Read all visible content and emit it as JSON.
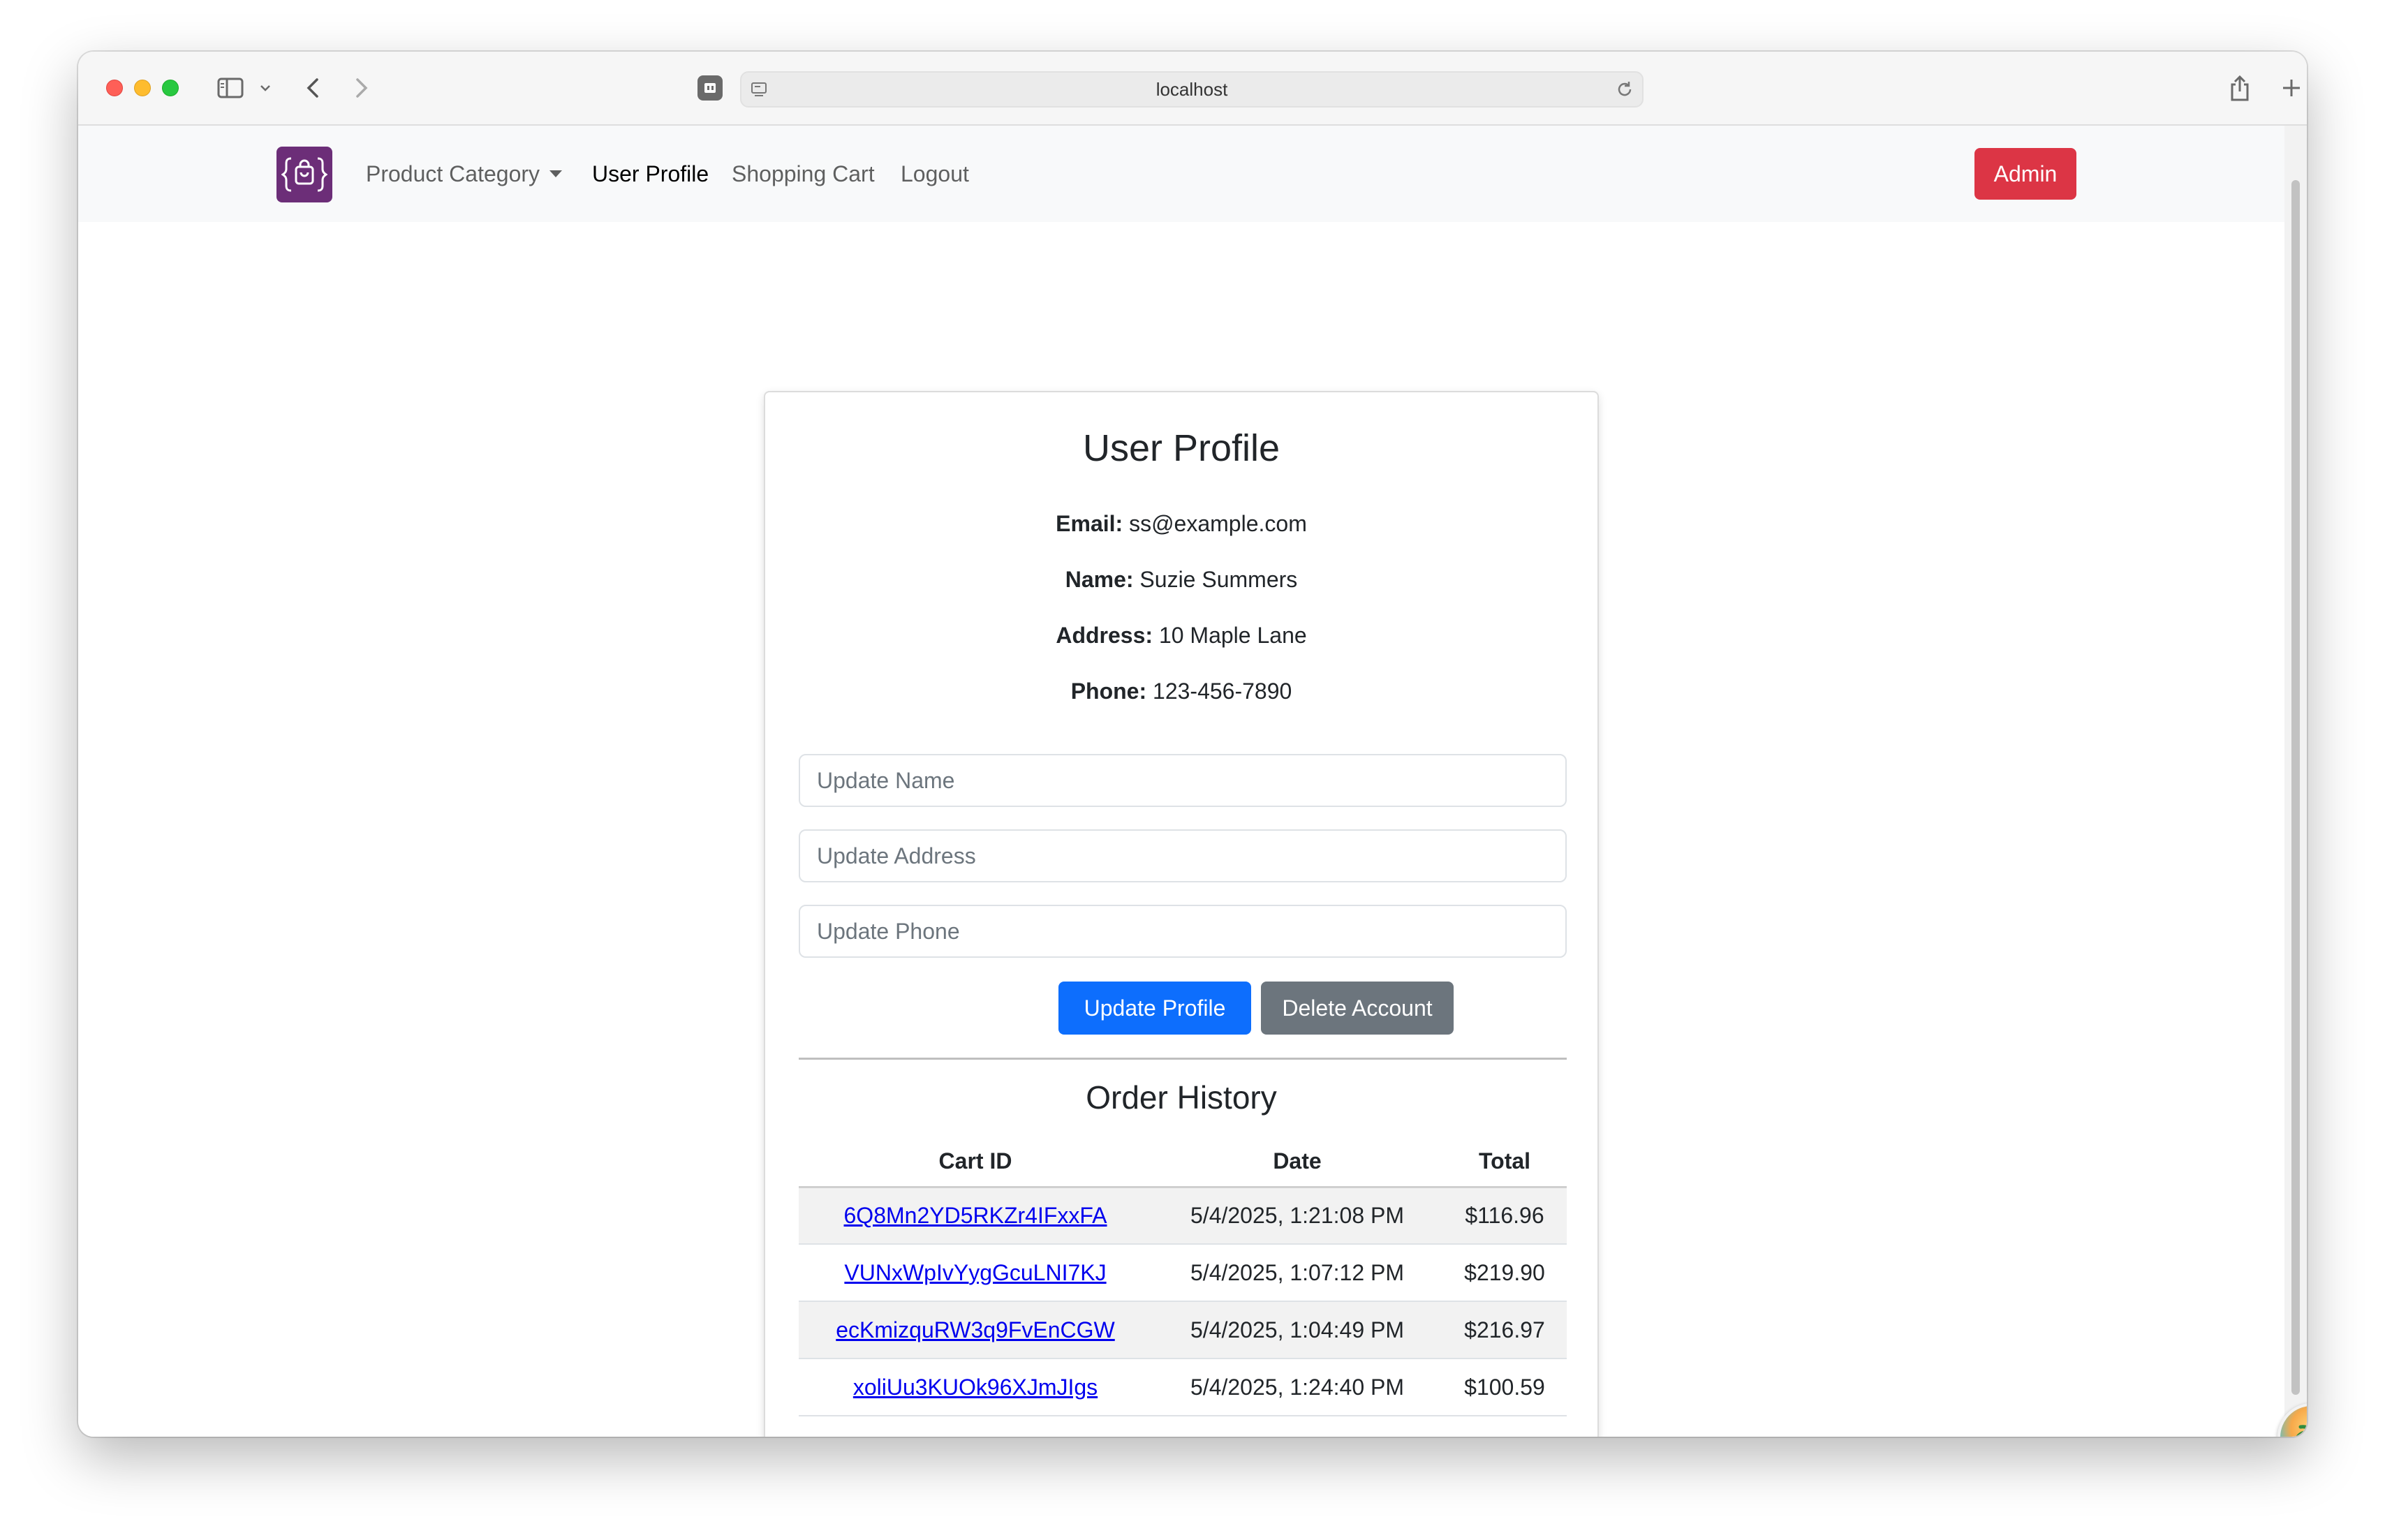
{
  "browser": {
    "url": "localhost"
  },
  "navbar": {
    "links": [
      {
        "label": "Product Category"
      },
      {
        "label": "User Profile"
      },
      {
        "label": "Shopping Cart"
      },
      {
        "label": "Logout"
      }
    ],
    "admin_label": "Admin",
    "brand_icon": "shopping-bag-code-icon",
    "brand_color": "#6c2e78"
  },
  "profile": {
    "title": "User Profile",
    "email_label": "Email:",
    "email": "ss@example.com",
    "name_label": "Name:",
    "name": "Suzie Summers",
    "address_label": "Address:",
    "address": "10 Maple Lane",
    "phone_label": "Phone:",
    "phone": "123-456-7890"
  },
  "form": {
    "name_placeholder": "Update Name",
    "address_placeholder": "Update Address",
    "phone_placeholder": "Update Phone",
    "update_label": "Update Profile",
    "delete_label": "Delete Account"
  },
  "orders": {
    "title": "Order History",
    "headers": [
      "Cart ID",
      "Date",
      "Total"
    ],
    "rows": [
      {
        "id": "6Q8Mn2YD5RKZr4IFxxFA",
        "date": "5/4/2025, 1:21:08 PM",
        "total": "$116.96"
      },
      {
        "id": "VUNxWpIvYygGcuLNI7KJ",
        "date": "5/4/2025, 1:07:12 PM",
        "total": "$219.90"
      },
      {
        "id": "ecKmizquRW3q9FvEnCGW",
        "date": "5/4/2025, 1:04:49 PM",
        "total": "$216.97"
      },
      {
        "id": "xoliUu3KUOk96XJmJIgs",
        "date": "5/4/2025, 1:24:40 PM",
        "total": "$100.59"
      }
    ]
  },
  "colors": {
    "primary": "#0d6efd",
    "secondary": "#6c757d",
    "danger": "#dc3545",
    "link": "#0000ee"
  }
}
